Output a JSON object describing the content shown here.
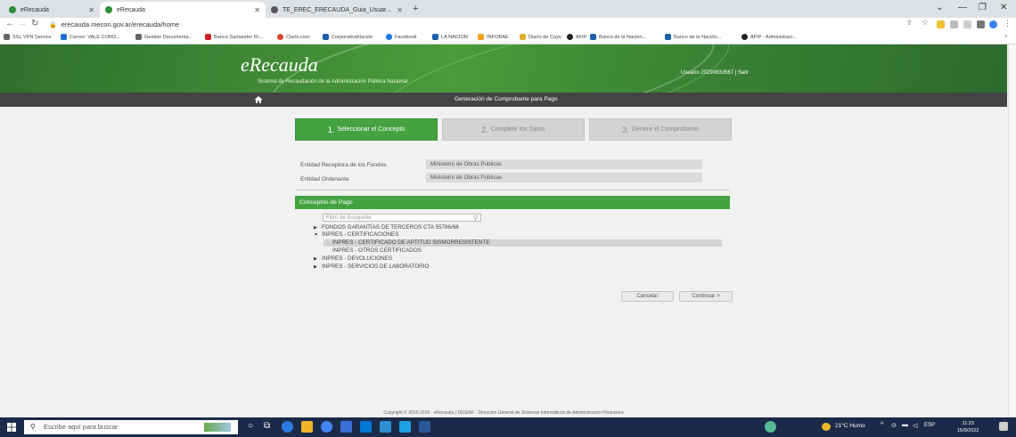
{
  "browser": {
    "tabs": [
      {
        "label": "eRecauda",
        "active": false
      },
      {
        "label": "eRecauda",
        "active": true
      },
      {
        "label": "TE_EREC_ERECAUDA_Guia_Usuar...",
        "active": false
      }
    ],
    "url": "erecauda.mecon.gov.ar/erecauda/home",
    "bookmarks": [
      "SSL VPN Service",
      "Correo: VALE CORD...",
      "Gestión Documenta...",
      "Banco Santander Ri...",
      "Clarin.com",
      "CorporativaNación",
      "Facebook",
      "LA NACION",
      "INFOBAE",
      "Diario de Cuyo",
      "AFIP",
      "Banco de la Nación...",
      "Banco de la Nación...",
      "AFIP - Administraci..."
    ]
  },
  "header": {
    "logo": "eRecauda",
    "subtitle": "Sistema de Recaudación de la Administración Pública Nacional",
    "user": "Usuario 20290833567 | Salir"
  },
  "nav": {
    "title": "Generación de Comprobante para Pago"
  },
  "steps": [
    {
      "num": "1.",
      "label": "Seleccionar el Concepto",
      "active": true
    },
    {
      "num": "2.",
      "label": "Complete los Datos",
      "active": false
    },
    {
      "num": "3.",
      "label": "Genere el Comprobante",
      "active": false
    }
  ],
  "fields": [
    {
      "label": "Entidad Receptora de los Fondos",
      "value": "Ministerio de Obras Publicas"
    },
    {
      "label": "Entidad Ordenante",
      "value": "Ministerio de Obras Publicas"
    }
  ],
  "panel": {
    "title": "Conceptos de Pago",
    "filter_placeholder": "Filtro de Busqueda",
    "tree": [
      {
        "label": "FONDOS GARANTÍAS DE TERCEROS CTA 55796/68",
        "expanded": false,
        "level": 0
      },
      {
        "label": "INPRES - CERTIFICACIONES",
        "expanded": true,
        "level": 0
      },
      {
        "label": "INPRES - CERTIFICADO DE APTITUD SISMORRESISTENTE",
        "level": 1,
        "selected": true
      },
      {
        "label": "INPRES - OTROS CERTIFICADOS",
        "level": 1
      },
      {
        "label": "INPRES - DEVOLUCIONES",
        "expanded": false,
        "level": 0
      },
      {
        "label": "INPRES - SERVICIOS DE LABORATORIO",
        "expanded": false,
        "level": 0
      }
    ],
    "cancel": "Cancelar",
    "continue": "Continuar >"
  },
  "footer": "Copyright © 2015-2016 - eRecauda | DGSIAF - Dirección General de Sistemas Informáticos de Administración Financiera",
  "taskbar": {
    "search_placeholder": "Escribe aquí para buscar",
    "weather": "21°C Humo",
    "lang": "ESP",
    "time": "11:23",
    "date": "15/9/2022"
  },
  "colors": {
    "green": "#44a340",
    "nav": "#444444"
  }
}
